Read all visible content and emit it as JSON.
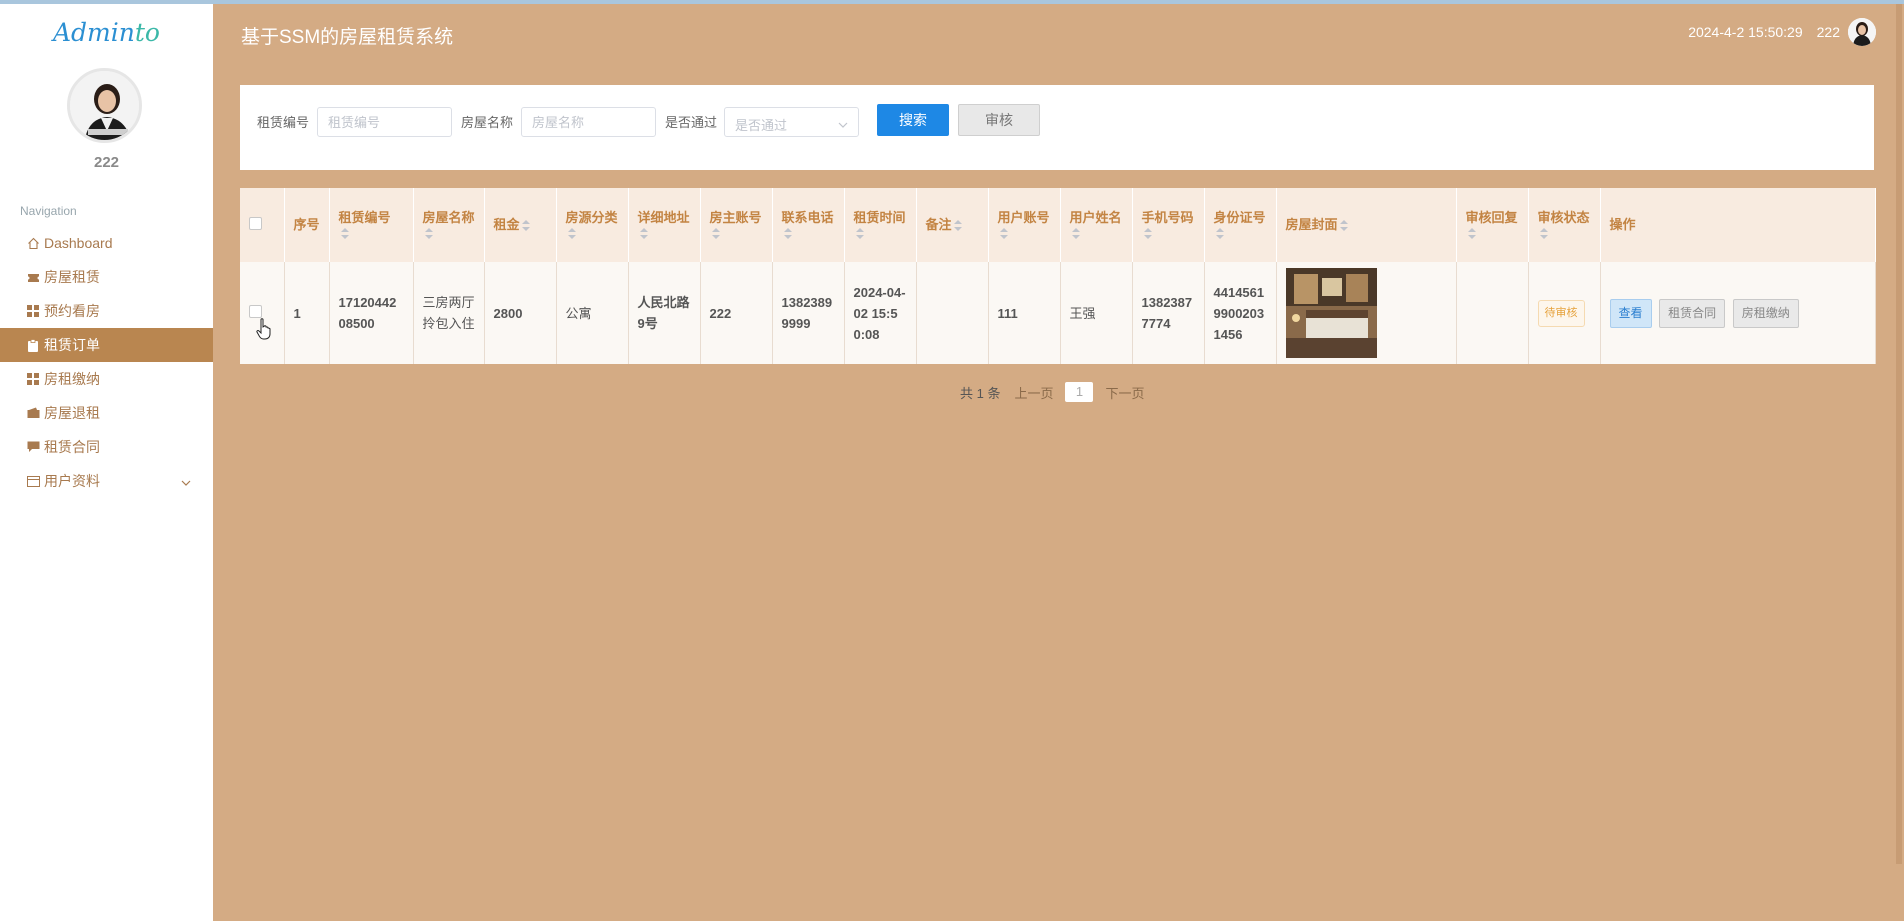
{
  "app": {
    "title": "基于SSM的房屋租赁系统",
    "logo_main": "Admin",
    "logo_accent": "to",
    "datetime": "2024-4-2 15:50:29",
    "header_user": "222"
  },
  "sidebar": {
    "username": "222",
    "nav_title": "Navigation",
    "items": [
      {
        "label": "Dashboard",
        "icon": "home-icon"
      },
      {
        "label": "房屋租赁",
        "icon": "ticket-icon"
      },
      {
        "label": "预约看房",
        "icon": "grid-icon"
      },
      {
        "label": "租赁订单",
        "icon": "clipboard-icon"
      },
      {
        "label": "房租缴纳",
        "icon": "grid-icon"
      },
      {
        "label": "房屋退租",
        "icon": "wallet-icon"
      },
      {
        "label": "租赁合同",
        "icon": "chat-icon"
      },
      {
        "label": "用户资料",
        "icon": "card-icon"
      }
    ]
  },
  "search": {
    "field1_label": "租赁编号",
    "field1_placeholder": "租赁编号",
    "field2_label": "房屋名称",
    "field2_placeholder": "房屋名称",
    "field3_label": "是否通过",
    "field3_value": "是否通过",
    "search_button": "搜索",
    "audit_button": "审核"
  },
  "table": {
    "columns": [
      "序号",
      "租赁编号",
      "房屋名称",
      "租金",
      "房源分类",
      "详细地址",
      "房主账号",
      "联系电话",
      "租赁时间",
      "备注",
      "用户账号",
      "用户姓名",
      "手机号码",
      "身份证号",
      "房屋封面",
      "审核回复",
      "审核状态",
      "操作"
    ],
    "rows": [
      {
        "index": "1",
        "rent_no": "1712044208500",
        "house_name": "三房两厅拎包入住",
        "rent": "2800",
        "category": "公寓",
        "address": "人民北路9号",
        "owner_account": "222",
        "contact_phone": "13823899999",
        "rent_time": "2024-04-02 15:50:08",
        "remark": "",
        "user_account": "111",
        "user_name": "王强",
        "mobile": "13823877774",
        "id_card": "441456199002031456",
        "reply": "",
        "status": "待审核",
        "actions": [
          "查看",
          "租赁合同",
          "房租缴纳"
        ]
      }
    ]
  },
  "pagination": {
    "total": "共 1 条",
    "prev": "上一页",
    "current": "1",
    "next": "下一页"
  }
}
